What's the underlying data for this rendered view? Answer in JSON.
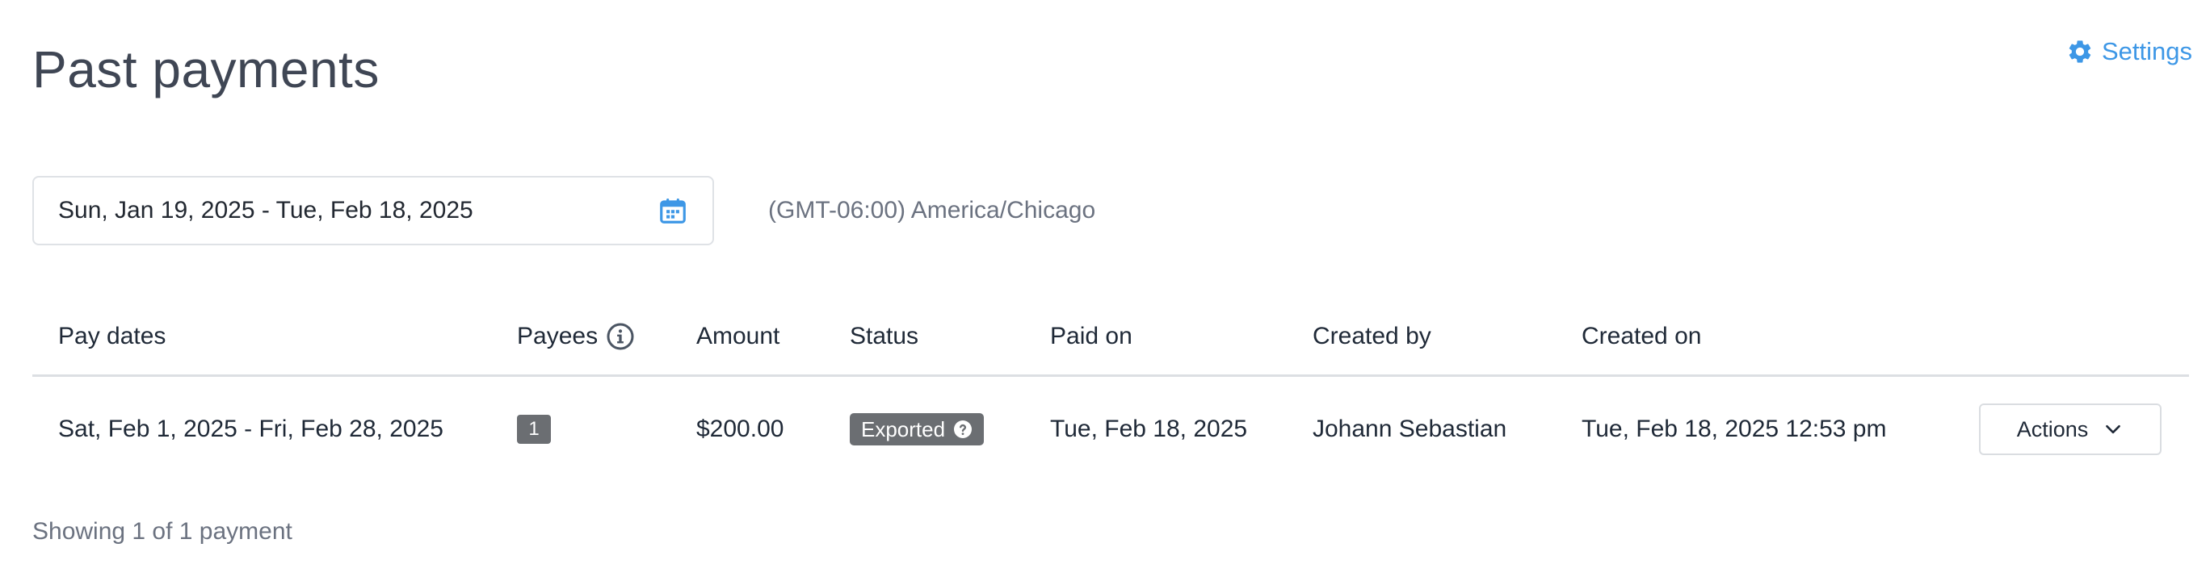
{
  "header": {
    "title": "Past payments",
    "settings_label": "Settings",
    "settings_icon": "gear-icon"
  },
  "filters": {
    "date_range": "Sun, Jan 19, 2025 - Tue, Feb 18, 2025",
    "date_range_icon": "calendar-icon",
    "timezone": "(GMT-06:00) America/Chicago"
  },
  "table": {
    "columns": [
      "Pay dates",
      "Payees",
      "Amount",
      "Status",
      "Paid on",
      "Created by",
      "Created on"
    ],
    "payees_info_icon": "info-icon",
    "rows": [
      {
        "pay_dates": "Sat, Feb 1, 2025 - Fri, Feb 28, 2025",
        "payees": "1",
        "amount": "$200.00",
        "status": "Exported",
        "status_icon": "question-circle-icon",
        "paid_on": "Tue, Feb 18, 2025",
        "created_by": "Johann Sebastian",
        "created_on": "Tue, Feb 18, 2025 12:53 pm",
        "actions_label": "Actions",
        "actions_icon": "chevron-down-icon"
      }
    ]
  },
  "footer": {
    "count_text": "Showing 1 of 1 payment"
  },
  "colors": {
    "accent": "#3d97e6",
    "badge": "#6b6e72",
    "muted_text": "#6b7280"
  }
}
